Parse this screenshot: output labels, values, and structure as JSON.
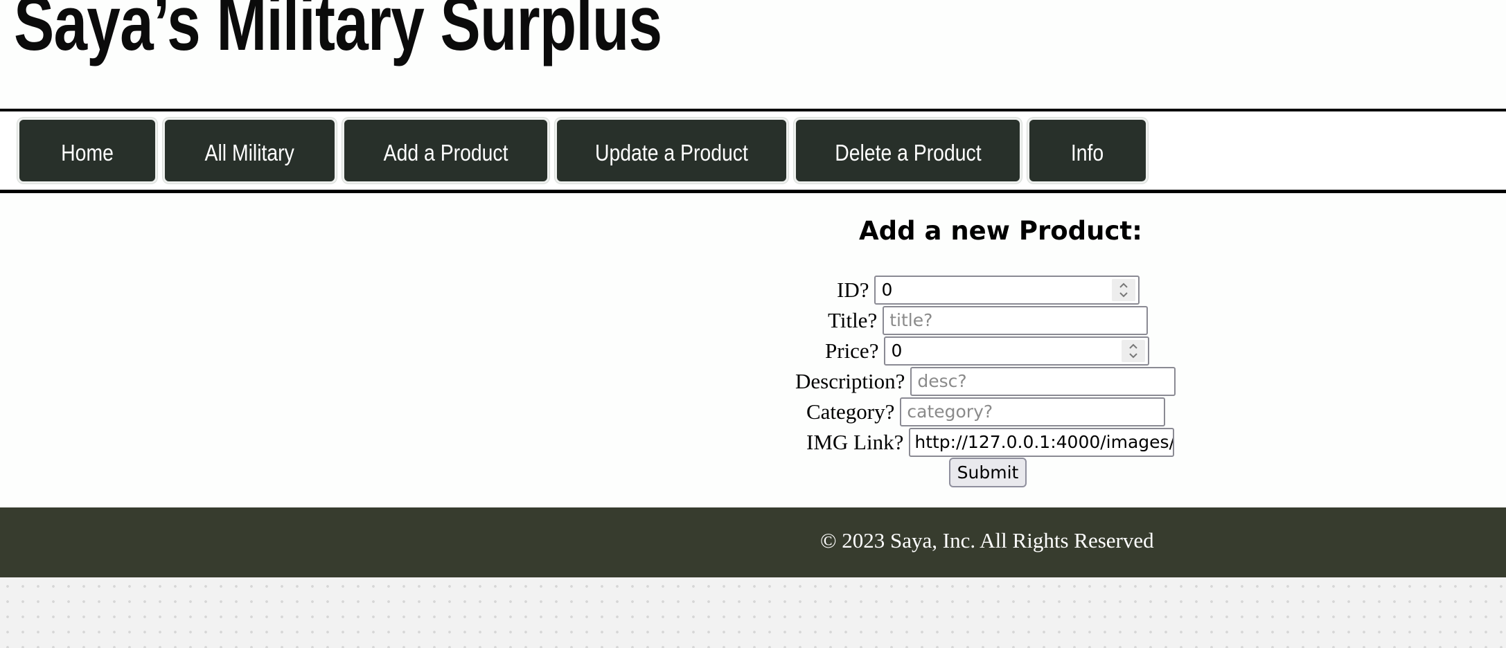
{
  "header": {
    "site_title": "Saya’s Military Surplus"
  },
  "nav": {
    "items": [
      {
        "label": "Home"
      },
      {
        "label": "All Military"
      },
      {
        "label": "Add a Product"
      },
      {
        "label": "Update a Product"
      },
      {
        "label": "Delete a Product"
      },
      {
        "label": "Info"
      }
    ]
  },
  "form": {
    "heading": "Add a new Product:",
    "fields": {
      "id": {
        "label": "ID?",
        "value": "0"
      },
      "title": {
        "label": "Title?",
        "placeholder": "title?"
      },
      "price": {
        "label": "Price?",
        "value": "0"
      },
      "description": {
        "label": "Description?",
        "placeholder": "desc?"
      },
      "category": {
        "label": "Category?",
        "placeholder": "category?"
      },
      "img_link": {
        "label": "IMG Link?",
        "value": "http://127.0.0.1:4000/images/"
      }
    },
    "submit_label": "Submit"
  },
  "footer": {
    "text": "© 2023 Saya, Inc. All Rights Reserved"
  },
  "colors": {
    "nav_button_bg": "#28302a",
    "footer_bg": "#373c2e"
  }
}
